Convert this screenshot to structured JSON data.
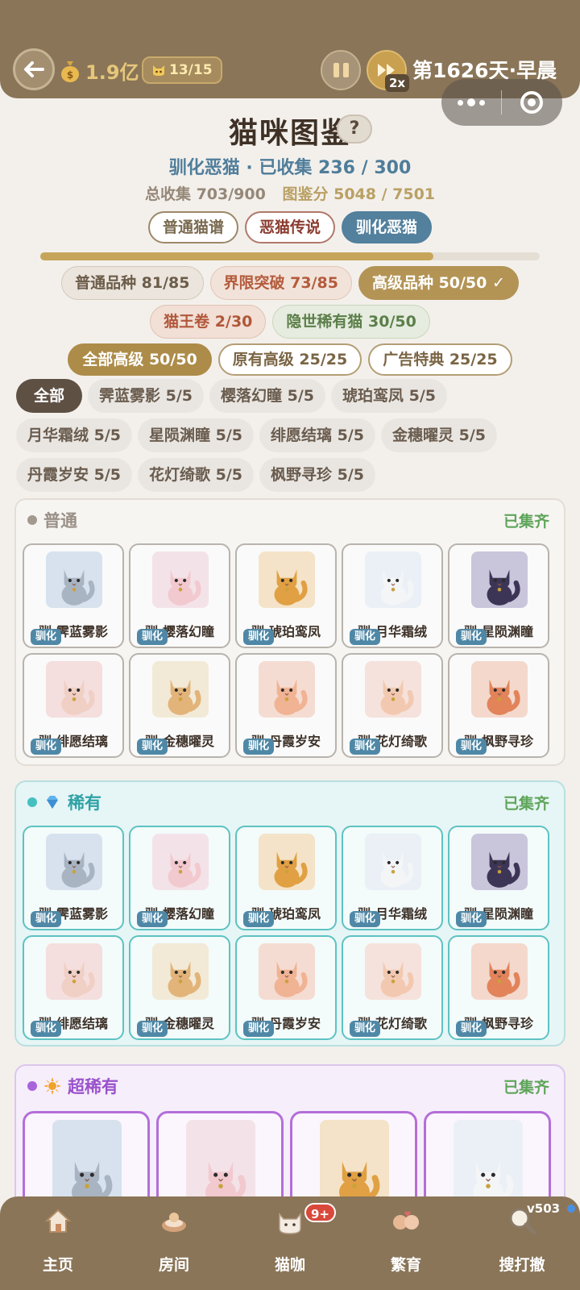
{
  "header": {
    "money": "1.9亿",
    "cat_count": "13/15",
    "speed": "2x",
    "day_label": "第1626天·早晨"
  },
  "title": {
    "text": "猫咪图鉴",
    "help": "?",
    "subtitle": "驯化恶猫 · 已收集 236 / 300",
    "total_collection": "总收集 703/900",
    "codex_score": "图鉴分 5048 / 7501"
  },
  "main_tabs": [
    "普通猫谱",
    "恶猫传说",
    "驯化恶猫"
  ],
  "progress": 0.787,
  "category_chips": {
    "normal": "普通品种 81/85",
    "breakthrough": "界限突破 73/85",
    "high": "高级品种 50/50 ✓",
    "king": "猫王卷 2/30",
    "hidden": "隐世稀有猫 30/50"
  },
  "high_filters": [
    "全部高级 50/50",
    "原有高级 25/25",
    "广告特典 25/25"
  ],
  "series_filters": [
    "全部",
    "霁蓝雾影 5/5",
    "樱落幻瞳 5/5",
    "琥珀鸾凤 5/5",
    "月华霜绒 5/5",
    "星陨渊瞳 5/5",
    "绯愿结璃 5/5",
    "金穗曜灵 5/5",
    "丹霞岁安 5/5",
    "花灯绮歌 5/5",
    "枫野寻珍 5/5"
  ],
  "tag_label": "驯化",
  "sections": {
    "normal": {
      "label": "普通",
      "status": "已集齐",
      "cards": [
        "驯·霁蓝雾影",
        "驯·樱落幻瞳",
        "驯·琥珀鸾凤",
        "驯·月华霜绒",
        "驯·星陨渊瞳",
        "驯·绯愿结璃",
        "驯·金穗曜灵",
        "驯·丹霞岁安",
        "驯·花灯绮歌",
        "驯·枫野寻珍"
      ]
    },
    "rare": {
      "label": "稀有",
      "status": "已集齐",
      "cards": [
        "驯·霁蓝雾影",
        "驯·樱落幻瞳",
        "驯·琥珀鸾凤",
        "驯·月华霜绒",
        "驯·星陨渊瞳",
        "驯·绯愿结璃",
        "驯·金穗曜灵",
        "驯·丹霞岁安",
        "驯·花灯绮歌",
        "驯·枫野寻珍"
      ]
    },
    "super_rare": {
      "label": "超稀有",
      "status": "已集齐"
    }
  },
  "cat_colors": [
    "#a9b4c2",
    "#f2c9cf",
    "#e0a043",
    "#f4f5f7",
    "#3d3556",
    "#f0cfc4",
    "#e2b47a",
    "#f0b393",
    "#f2c9b0",
    "#e2835a"
  ],
  "bg_colors": [
    "#d7e2ee",
    "#f3e3e8",
    "#f4e3c8",
    "#eaf0f6",
    "#c9c5db",
    "#f4dede",
    "#f2ead7",
    "#f5dcd2",
    "#f6e2dc",
    "#f4d8cc"
  ],
  "bottom_nav": [
    "主页",
    "房间",
    "猫咖",
    "繁育",
    "搜打撤"
  ],
  "nav_badge": "9+",
  "version": "v503"
}
